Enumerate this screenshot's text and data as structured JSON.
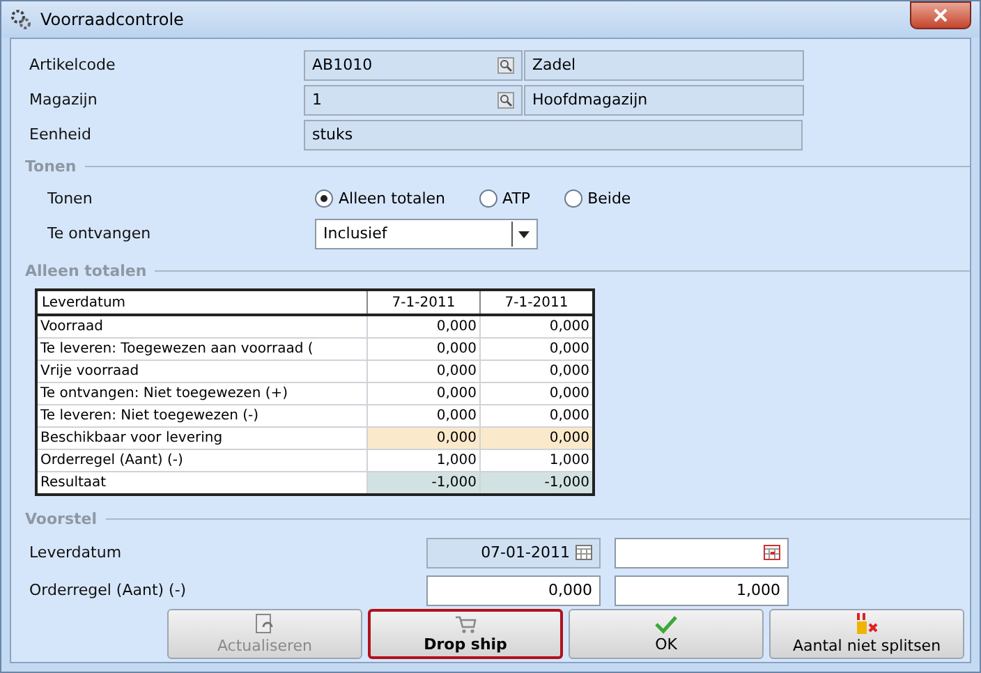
{
  "window": {
    "title": "Voorraadcontrole"
  },
  "fields": [
    {
      "label": "Artikelcode",
      "value": "AB1010",
      "lookup": true,
      "description": "Zadel"
    },
    {
      "label": "Magazijn",
      "value": "1",
      "lookup": true,
      "description": "Hoofdmagazijn"
    },
    {
      "label": "Eenheid",
      "value": "stuks",
      "lookup": false
    }
  ],
  "tonen": {
    "heading": "Tonen",
    "label": "Tonen",
    "options": [
      {
        "label": "Alleen totalen",
        "selected": true
      },
      {
        "label": "ATP",
        "selected": false
      },
      {
        "label": "Beide",
        "selected": false
      }
    ],
    "receive_label": "Te ontvangen",
    "receive_value": "Inclusief"
  },
  "totals": {
    "heading": "Alleen totalen",
    "columns": [
      "Leverdatum",
      "7-1-2011",
      "7-1-2011"
    ],
    "rows": [
      {
        "kind": "normal",
        "cells": [
          "Voorraad",
          "0,000",
          "0,000"
        ]
      },
      {
        "kind": "normal",
        "cells": [
          "Te leveren: Toegewezen aan voorraad (",
          "0,000",
          "0,000"
        ]
      },
      {
        "kind": "normal",
        "cells": [
          "Vrije voorraad",
          "0,000",
          "0,000"
        ]
      },
      {
        "kind": "normal",
        "cells": [
          "Te ontvangen: Niet toegewezen (+)",
          "0,000",
          "0,000"
        ]
      },
      {
        "kind": "normal",
        "cells": [
          "Te leveren: Niet toegewezen (-)",
          "0,000",
          "0,000"
        ]
      },
      {
        "kind": "available",
        "cells": [
          "Beschikbaar voor levering",
          "0,000",
          "0,000"
        ]
      },
      {
        "kind": "normal",
        "cells": [
          "Orderregel (Aant) (-)",
          "1,000",
          "1,000"
        ]
      },
      {
        "kind": "result",
        "cells": [
          "Resultaat",
          "-1,000",
          "-1,000"
        ]
      }
    ]
  },
  "voorstel": {
    "heading": "Voorstel",
    "rows": [
      {
        "label": "Leverdatum",
        "kind": "date",
        "inputs": [
          {
            "value": "07-01-2011",
            "readonly": true
          },
          {
            "readonly": false
          }
        ]
      },
      {
        "label": "Orderregel (Aant) (-)",
        "kind": "number",
        "inputs": [
          {
            "value": "0,000",
            "readonly": false
          },
          {
            "value": "1,000",
            "readonly": false
          }
        ]
      }
    ]
  },
  "buttons": [
    {
      "label": "Actualiseren",
      "disabled": true,
      "focused": false
    },
    {
      "label": "Drop ship",
      "disabled": false,
      "focused": true
    },
    {
      "label": "OK",
      "disabled": false,
      "focused": false
    },
    {
      "label": "Aantal niet splitsen",
      "disabled": false,
      "focused": false
    }
  ]
}
